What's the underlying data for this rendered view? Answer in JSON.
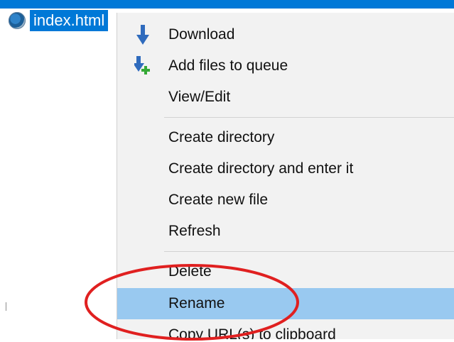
{
  "file": {
    "name": "index.html",
    "icon": "chrome-html-file-icon"
  },
  "menu": {
    "items": [
      {
        "label": "Download",
        "icon": "download-arrow-icon"
      },
      {
        "label": "Add files to queue",
        "icon": "add-to-queue-icon"
      },
      {
        "label": "View/Edit",
        "icon": ""
      },
      {
        "label": "Create directory",
        "icon": ""
      },
      {
        "label": "Create directory and enter it",
        "icon": ""
      },
      {
        "label": "Create new file",
        "icon": ""
      },
      {
        "label": "Refresh",
        "icon": ""
      },
      {
        "label": "Delete",
        "icon": ""
      },
      {
        "label": "Rename",
        "icon": ""
      },
      {
        "label": "Copy URL(s) to clipboard",
        "icon": ""
      }
    ],
    "highlighted_item": "Rename"
  },
  "colors": {
    "selection": "#0078d7",
    "menu_background": "#f2f2f2",
    "menu_highlight": "#99c9f0",
    "annotation_circle": "#e02020"
  }
}
